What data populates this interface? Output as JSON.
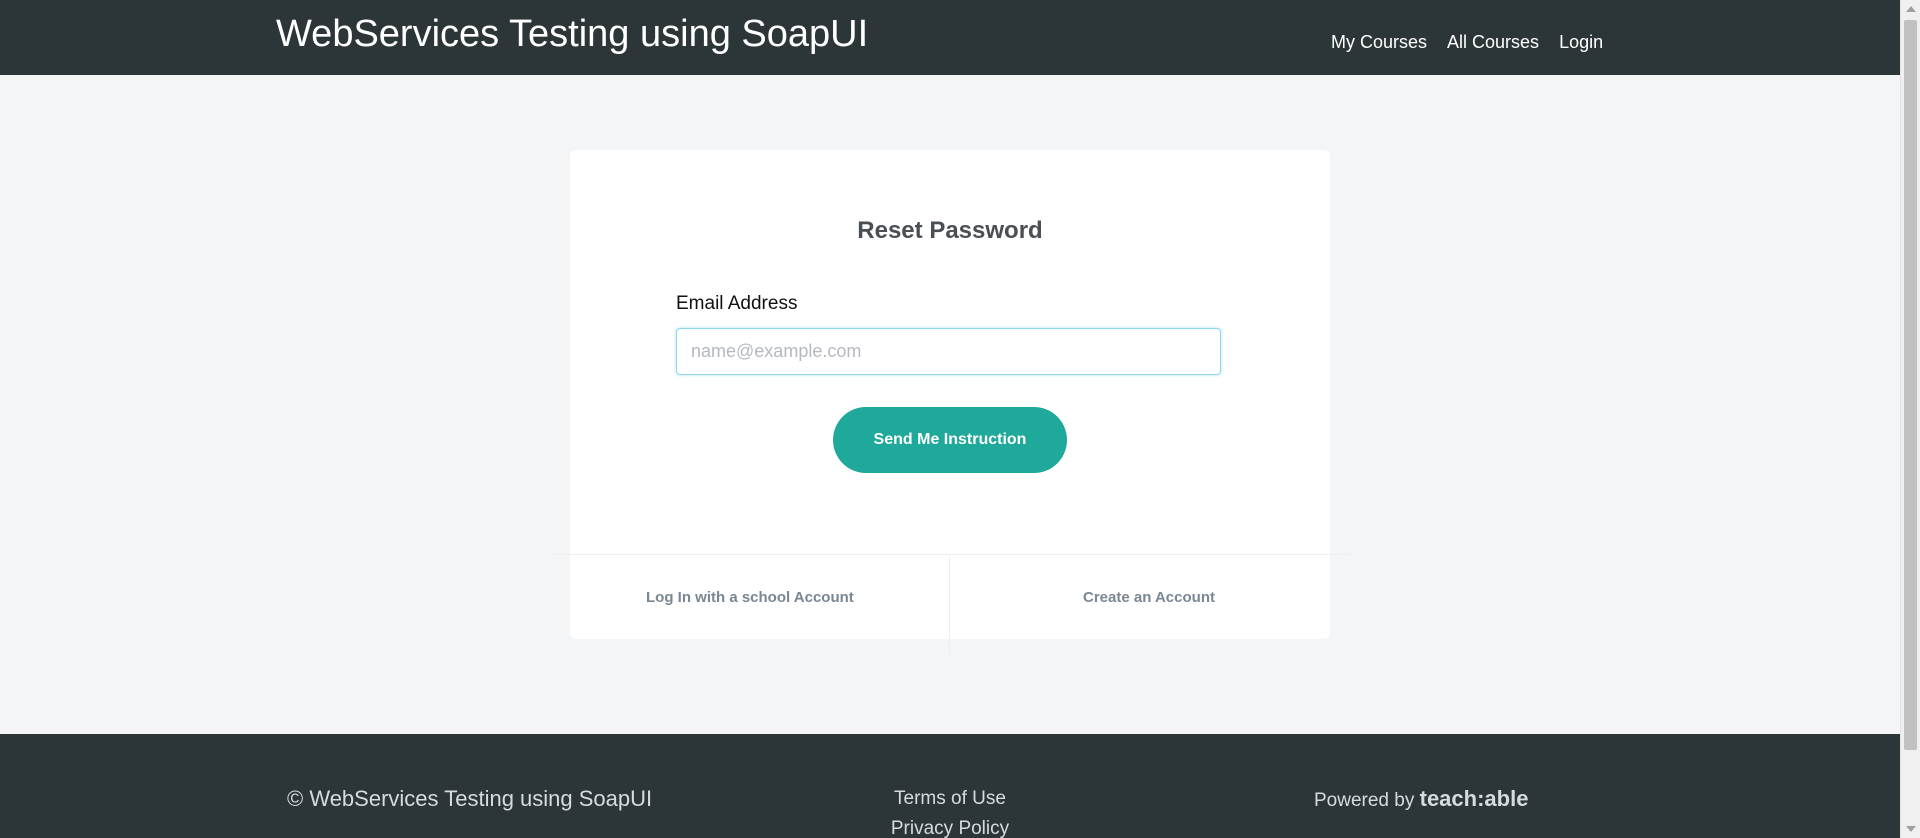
{
  "header": {
    "site_title": "WebServices Testing using SoapUI",
    "nav": {
      "my_courses": "My Courses",
      "all_courses": "All Courses",
      "login": "Login"
    }
  },
  "reset_form": {
    "title": "Reset Password",
    "email_label": "Email Address",
    "email_value": "",
    "email_placeholder": "name@example.com",
    "submit_label": "Send Me Instruction",
    "school_login_link": "Log In with a school Account",
    "create_account_link": "Create an Account"
  },
  "footer": {
    "copyright": "© WebServices Testing using SoapUI",
    "terms": "Terms of Use",
    "privacy": "Privacy Policy",
    "powered_by": "Powered by",
    "brand": "teach:able"
  },
  "colors": {
    "header_bg": "#2c3638",
    "accent": "#1fa99a",
    "page_bg": "#f4f5f7"
  }
}
